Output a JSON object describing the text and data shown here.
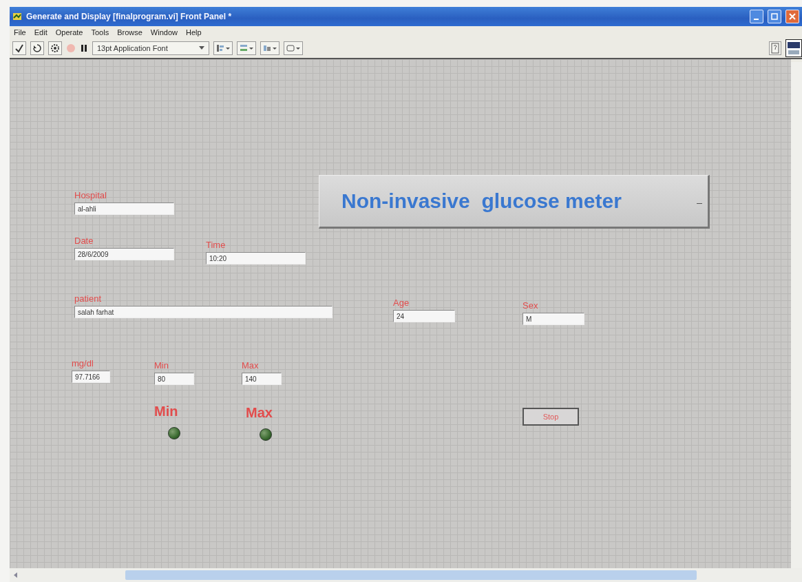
{
  "window": {
    "title": "Generate and Display [finalprogram.vi] Front Panel *"
  },
  "menu": [
    "File",
    "Edit",
    "Operate",
    "Tools",
    "Browse",
    "Window",
    "Help"
  ],
  "toolbar": {
    "font": "13pt Application Font"
  },
  "banner": {
    "text": "Non-invasive  glucose meter"
  },
  "controls": [
    {
      "kind": "field",
      "label": "Hospital",
      "value": "al-ahli"
    },
    {
      "kind": "field",
      "label": "Date",
      "value": "28/6/2009"
    },
    {
      "kind": "field",
      "label": "Time",
      "value": "10:20"
    },
    {
      "kind": "field",
      "label": "patient",
      "value": "salah farhat"
    },
    {
      "kind": "field",
      "label": "Age",
      "value": "24"
    },
    {
      "kind": "field",
      "label": "Sex",
      "value": "M"
    },
    {
      "kind": "field",
      "label": "mg/dl",
      "value": "97.7166"
    },
    {
      "kind": "field",
      "label": "Min",
      "value": "80"
    },
    {
      "kind": "field",
      "label": "Max",
      "value": "140"
    },
    {
      "kind": "led",
      "label": "Min",
      "on": false
    },
    {
      "kind": "led",
      "label": "Max",
      "on": false
    },
    {
      "kind": "button",
      "label": "Stop"
    }
  ]
}
